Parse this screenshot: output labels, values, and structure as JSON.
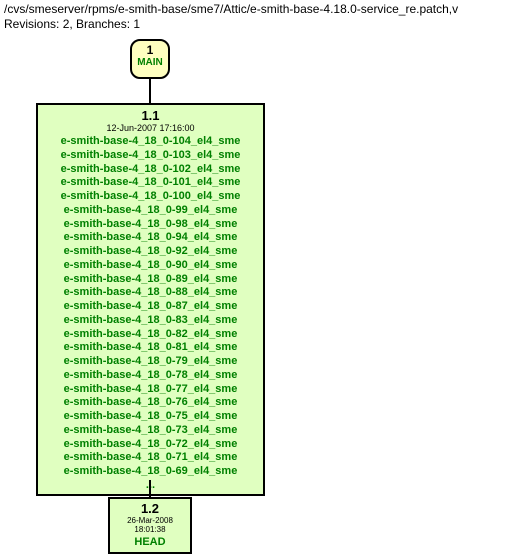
{
  "header": {
    "path": "/cvs/smeserver/rpms/e-smith-base/sme7/Attic/e-smith-base-4.18.0-service_re.patch,v",
    "revisions": "Revisions: 2, Branches: 1"
  },
  "branch": {
    "number": "1",
    "label": "MAIN"
  },
  "rev1": {
    "number": "1.1",
    "date": "12-Jun-2007 17:16:00",
    "tags": [
      "e-smith-base-4_18_0-104_el4_sme",
      "e-smith-base-4_18_0-103_el4_sme",
      "e-smith-base-4_18_0-102_el4_sme",
      "e-smith-base-4_18_0-101_el4_sme",
      "e-smith-base-4_18_0-100_el4_sme",
      "e-smith-base-4_18_0-99_el4_sme",
      "e-smith-base-4_18_0-98_el4_sme",
      "e-smith-base-4_18_0-94_el4_sme",
      "e-smith-base-4_18_0-92_el4_sme",
      "e-smith-base-4_18_0-90_el4_sme",
      "e-smith-base-4_18_0-89_el4_sme",
      "e-smith-base-4_18_0-88_el4_sme",
      "e-smith-base-4_18_0-87_el4_sme",
      "e-smith-base-4_18_0-83_el4_sme",
      "e-smith-base-4_18_0-82_el4_sme",
      "e-smith-base-4_18_0-81_el4_sme",
      "e-smith-base-4_18_0-79_el4_sme",
      "e-smith-base-4_18_0-78_el4_sme",
      "e-smith-base-4_18_0-77_el4_sme",
      "e-smith-base-4_18_0-76_el4_sme",
      "e-smith-base-4_18_0-75_el4_sme",
      "e-smith-base-4_18_0-73_el4_sme",
      "e-smith-base-4_18_0-72_el4_sme",
      "e-smith-base-4_18_0-71_el4_sme",
      "e-smith-base-4_18_0-69_el4_sme"
    ],
    "ellipsis": "..."
  },
  "rev2": {
    "number": "1.2",
    "date": "26-Mar-2008 18:01:38",
    "label": "HEAD"
  }
}
